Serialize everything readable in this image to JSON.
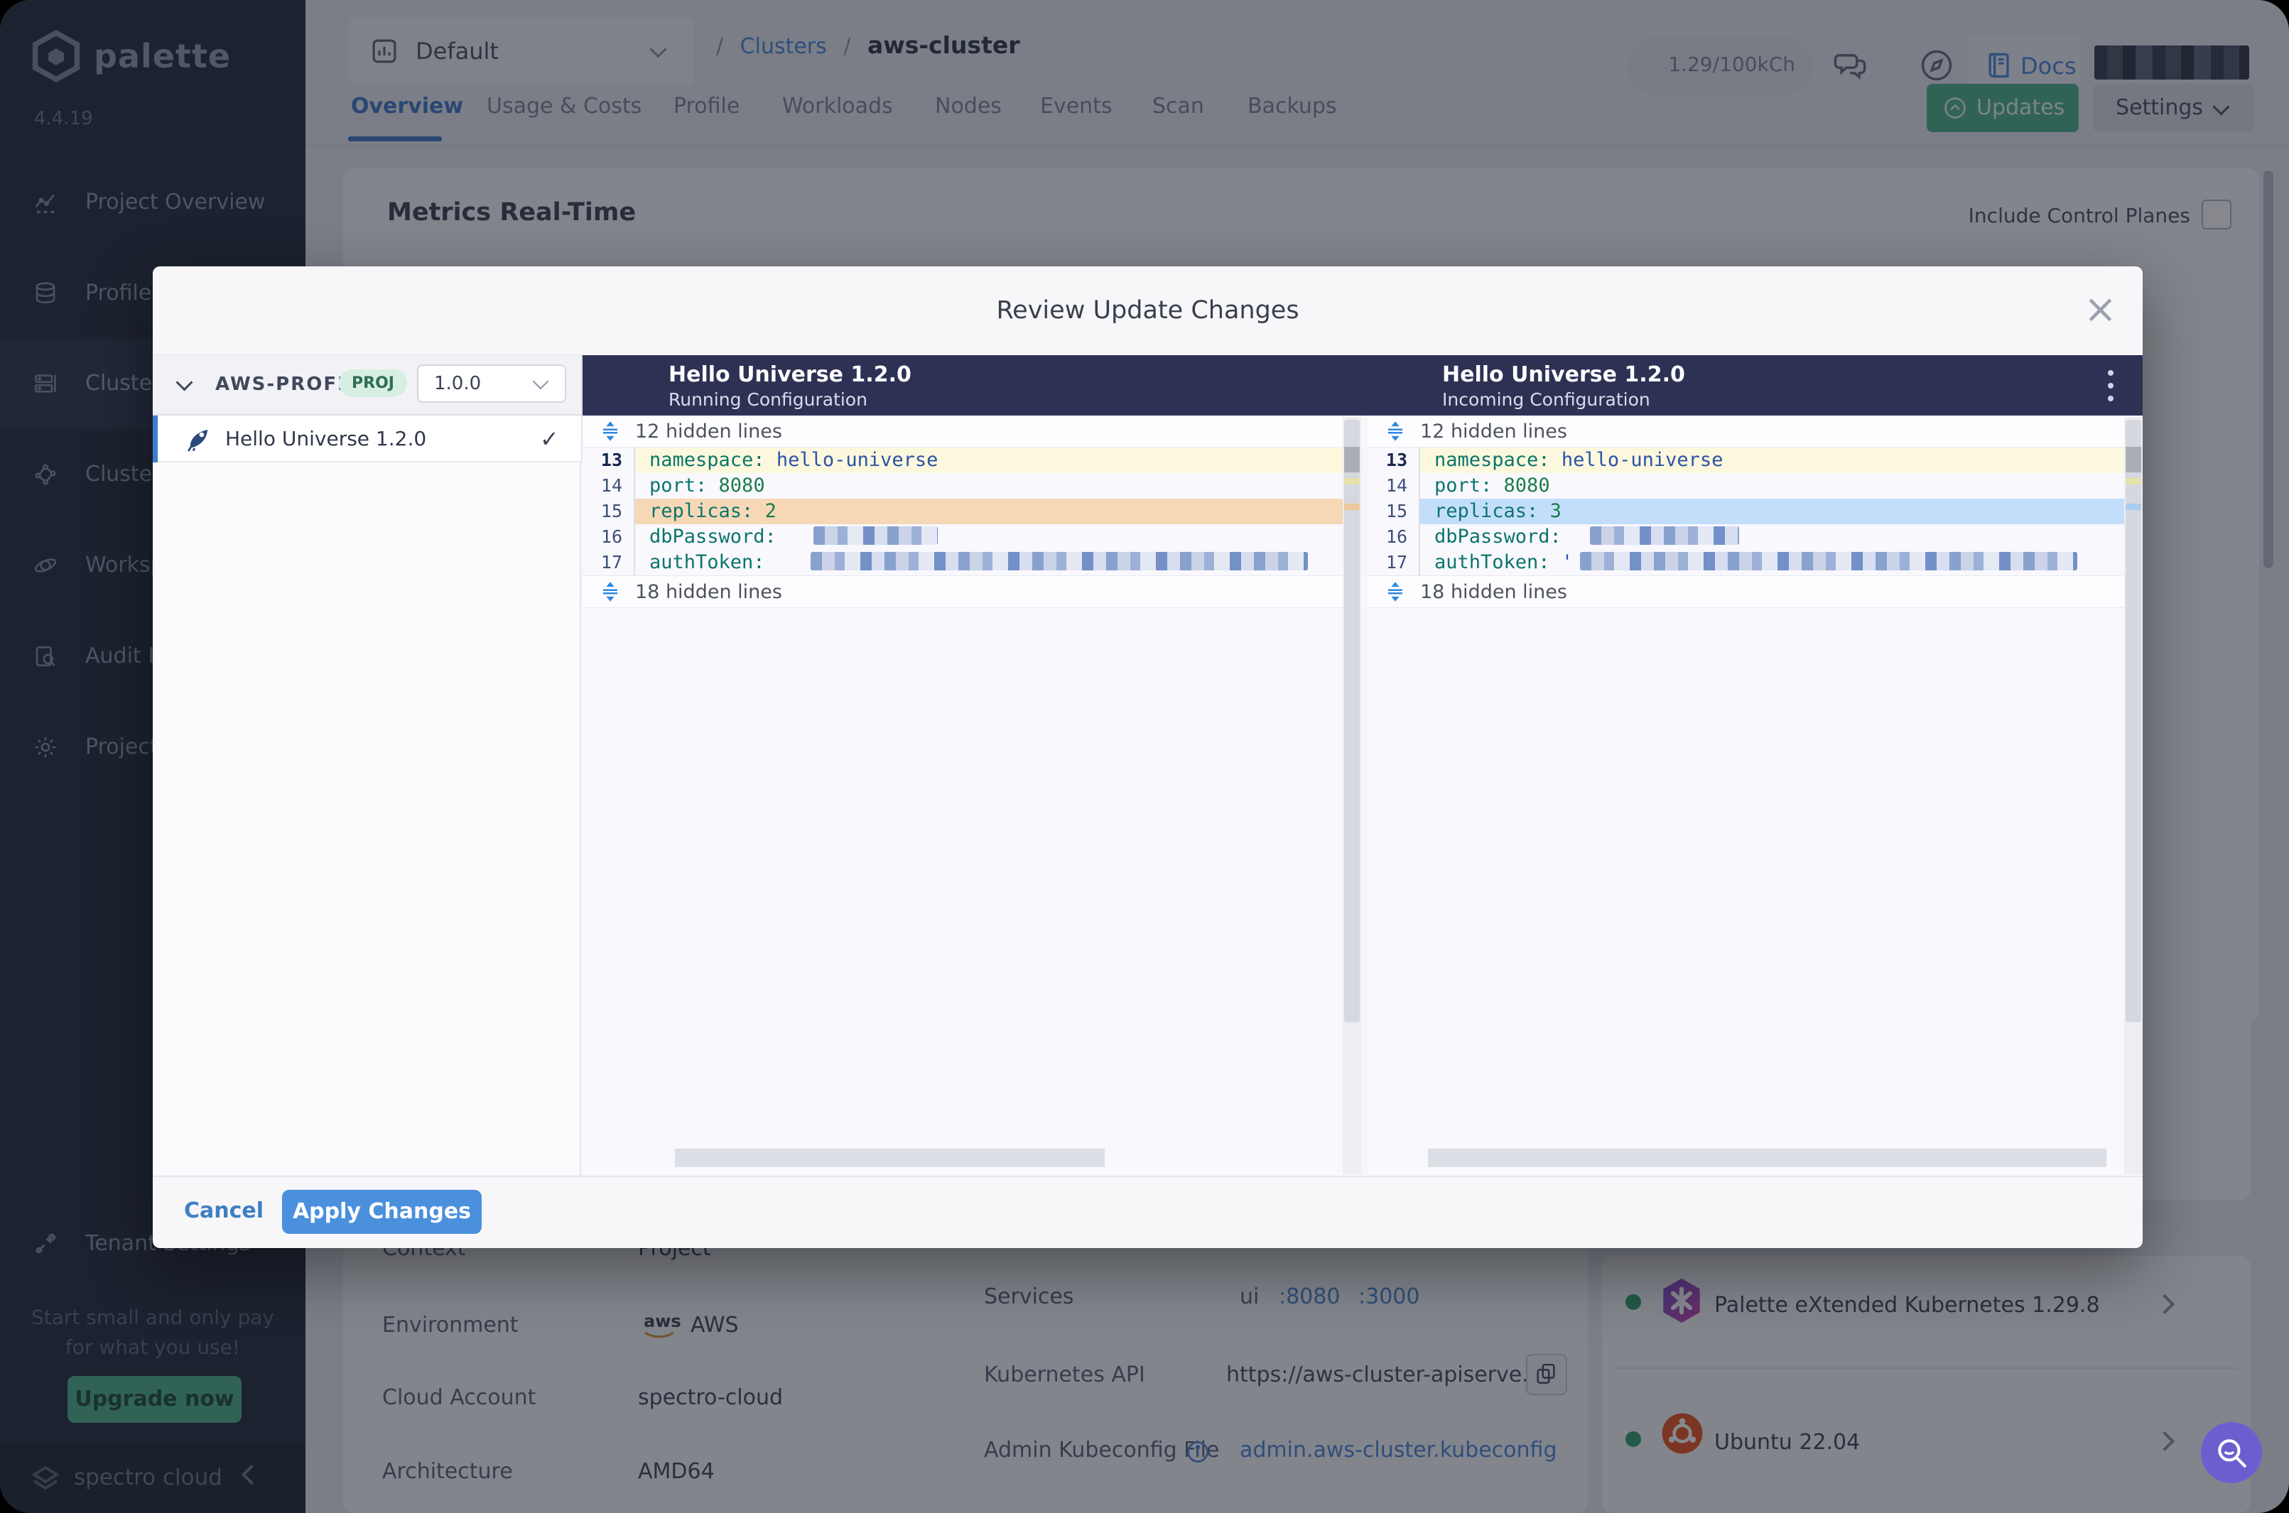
{
  "sidebar": {
    "brand": "palette",
    "version": "4.4.19",
    "items": [
      {
        "label": "Project Overview"
      },
      {
        "label": "Profiles"
      },
      {
        "label": "Clusters"
      },
      {
        "label": "Cluster Groups"
      },
      {
        "label": "Workspaces"
      },
      {
        "label": "Audit Logs"
      },
      {
        "label": "Project Settings"
      }
    ],
    "tenant_settings": "Tenant Settings",
    "promo_line1": "Start small and only pay",
    "promo_line2": "for what you use!",
    "upgrade_label": "Upgrade now",
    "footer_brand": "spectro cloud"
  },
  "topbar": {
    "project": "Default",
    "breadcrumb_sep": "/",
    "breadcrumb_1": "Clusters",
    "breadcrumb_2": "aws-cluster",
    "usage": "1.29/100kCh",
    "docs": "Docs"
  },
  "tabs": [
    "Overview",
    "Usage & Costs",
    "Profile",
    "Workloads",
    "Nodes",
    "Events",
    "Scan",
    "Backups"
  ],
  "actions": {
    "updates": "Updates",
    "settings": "Settings"
  },
  "content": {
    "metrics_title": "Metrics Real-Time",
    "include_control_planes": "Include Control Planes",
    "rows_left": [
      {
        "label": "Context",
        "value": "Project"
      },
      {
        "label": "Environment",
        "value": "AWS"
      },
      {
        "label": "Cloud Account",
        "value": "spectro-cloud"
      },
      {
        "label": "Architecture",
        "value": "AMD64"
      }
    ],
    "services_label": "Services",
    "services_name": "ui",
    "services_port1": ":8080",
    "services_port2": ":3000",
    "k8s_api_label": "Kubernetes API",
    "k8s_api_value": "https://aws-cluster-apiserve...",
    "kubeconfig_label": "Admin Kubeconfig File",
    "kubeconfig_value": "admin.aws-cluster.kubeconfig",
    "packs": [
      {
        "name": "Palette eXtended Kubernetes 1.29.8"
      },
      {
        "name": "Ubuntu 22.04"
      }
    ]
  },
  "modal": {
    "title": "Review Update Changes",
    "profile_name": "AWS-PROFILE",
    "profile_scope": "PROJ",
    "profile_version": "1.0.0",
    "profile_item": "Hello Universe 1.2.0",
    "check": "✓",
    "panels": [
      {
        "title": "Hello Universe 1.2.0",
        "subtitle": "Running Configuration",
        "hidden_top": "12 hidden lines",
        "hidden_bottom": "18 hidden lines",
        "lines": [
          {
            "no": "13",
            "key": "namespace:",
            "value": "hello-universe"
          },
          {
            "no": "14",
            "key": "port:",
            "value": "8080"
          },
          {
            "no": "15",
            "key": "replicas:",
            "value": "2"
          },
          {
            "no": "16",
            "key": "dbPassword:",
            "value": ""
          },
          {
            "no": "17",
            "key": "authToken:",
            "value": ""
          }
        ]
      },
      {
        "title": "Hello Universe 1.2.0",
        "subtitle": "Incoming Configuration",
        "hidden_top": "12 hidden lines",
        "hidden_bottom": "18 hidden lines",
        "lines": [
          {
            "no": "13",
            "key": "namespace:",
            "value": "hello-universe"
          },
          {
            "no": "14",
            "key": "port:",
            "value": "8080"
          },
          {
            "no": "15",
            "key": "replicas:",
            "value": "3"
          },
          {
            "no": "16",
            "key": "dbPassword:",
            "value": ""
          },
          {
            "no": "17",
            "key": "authToken:",
            "value": "'"
          }
        ]
      }
    ],
    "cancel": "Cancel",
    "apply": "Apply Changes"
  },
  "colors": {
    "accent_blue": "#4a90dd",
    "green": "#4cb28b",
    "navy_header": "#2d3254",
    "diff_context": "#fbf8dd",
    "diff_remove": "#f6d8b7",
    "diff_add": "#c3defa",
    "fab_purple": "#6b5fd0"
  }
}
